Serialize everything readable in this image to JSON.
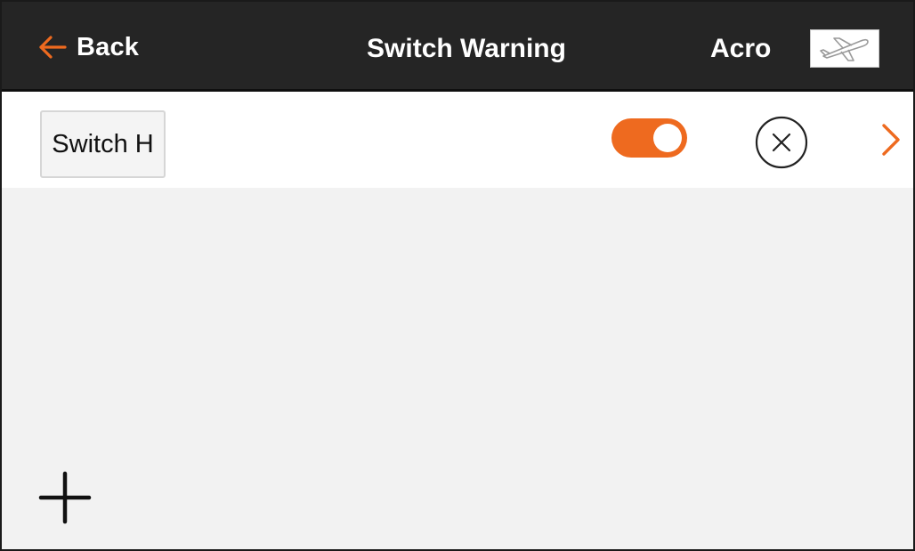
{
  "header": {
    "back_label": "Back",
    "title": "Switch Warning",
    "model_name": "Acro",
    "back_icon": "arrow-left-icon",
    "model_icon": "airplane-icon"
  },
  "warning_list": [
    {
      "switch_label": "Switch H",
      "enabled": true,
      "delete_icon": "close-circle-icon",
      "detail_icon": "chevron-right-icon"
    }
  ],
  "footer": {
    "add_icon": "plus-icon"
  },
  "colors": {
    "header_background": "#252525",
    "accent": "#ee6a1f",
    "page_background": "#f2f2f2",
    "row_background": "#ffffff"
  }
}
